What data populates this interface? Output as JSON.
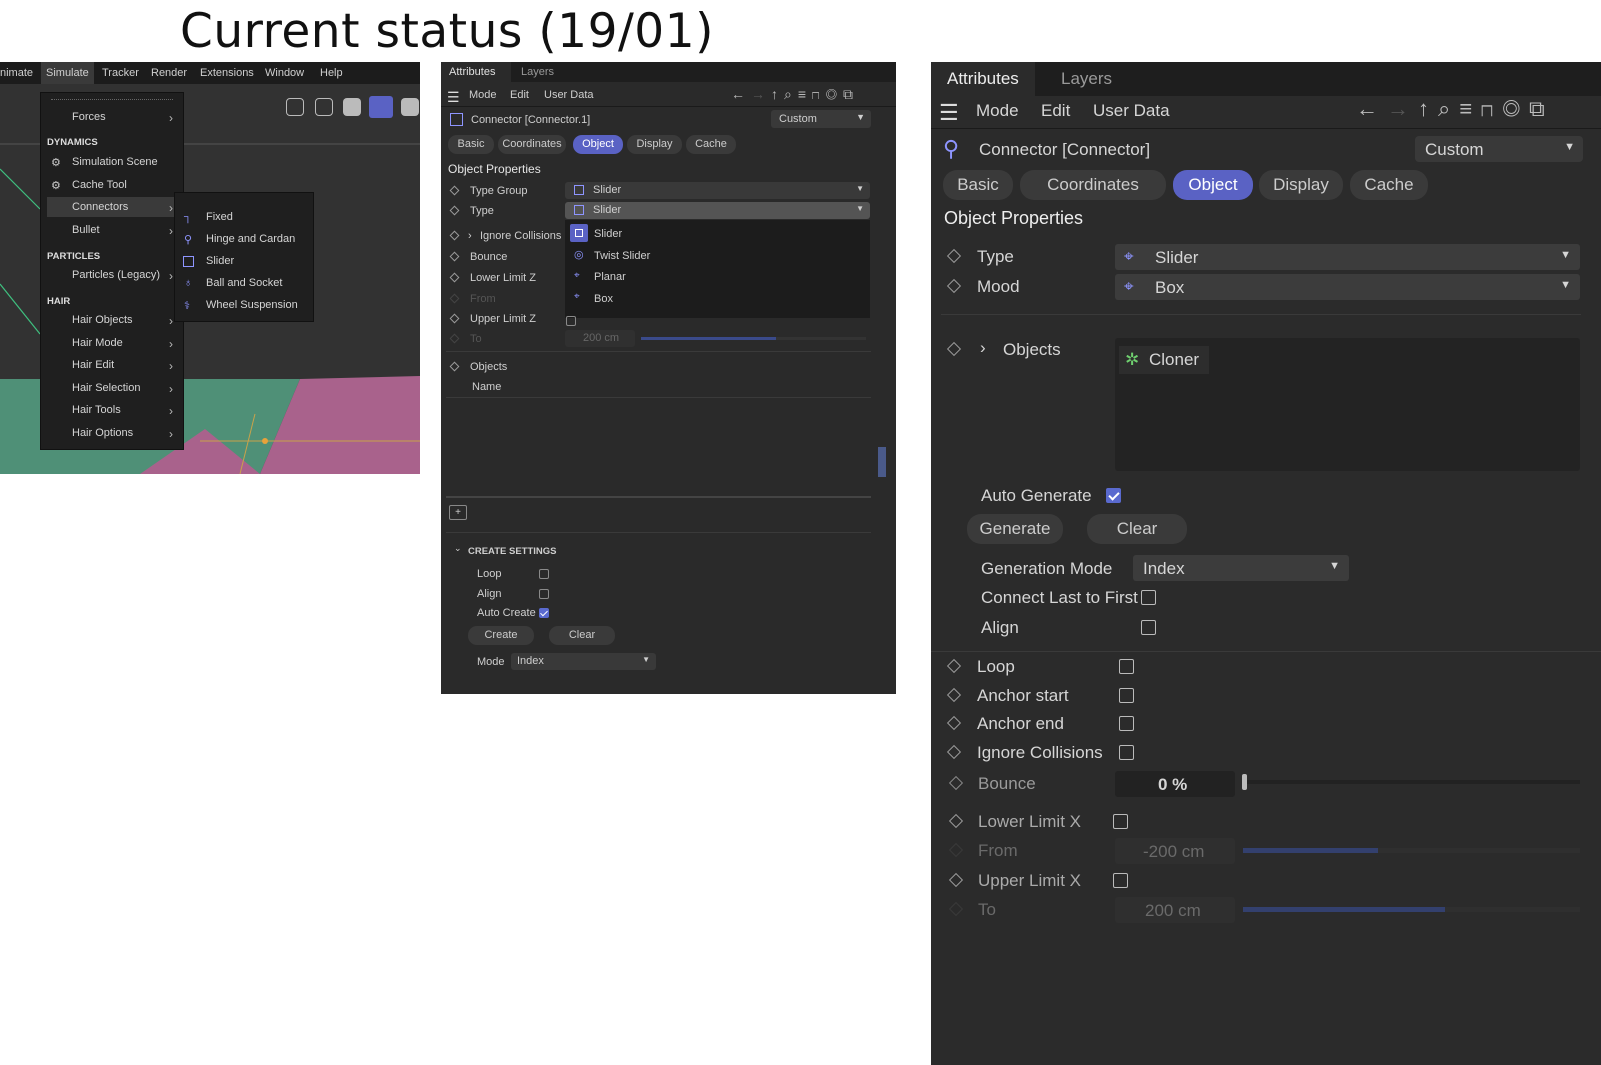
{
  "title": "Current status (19/01)",
  "panel1": {
    "menubar": [
      "nimate",
      "Simulate",
      "Tracker",
      "Render",
      "Extensions",
      "Window",
      "Help"
    ],
    "menu": {
      "forces": "Forces",
      "dynamics_header": "DYNAMICS",
      "simulation_scene": "Simulation Scene",
      "cache_tool": "Cache Tool",
      "connectors": "Connectors",
      "bullet": "Bullet",
      "particles_header": "PARTICLES",
      "particles_legacy": "Particles (Legacy)",
      "hair_header": "HAIR",
      "hair_items": [
        "Hair Objects",
        "Hair Mode",
        "Hair Edit",
        "Hair Selection",
        "Hair Tools",
        "Hair Options"
      ]
    },
    "submenu": [
      "Fixed",
      "Hinge and Cardan",
      "Slider",
      "Ball and Socket",
      "Wheel Suspension"
    ]
  },
  "panel2": {
    "tabs_top": [
      "Attributes",
      "Layers"
    ],
    "menu": [
      "Mode",
      "Edit",
      "User Data"
    ],
    "object_name": "Connector [Connector.1]",
    "preset": "Custom",
    "tabs": [
      "Basic",
      "Coordinates",
      "Object",
      "Display",
      "Cache"
    ],
    "section": "Object Properties",
    "labels": {
      "type_group": "Type Group",
      "type": "Type",
      "ignore_collisions": "Ignore Collisions",
      "bounce": "Bounce",
      "lower_limit": "Lower Limit Z",
      "from": "From",
      "upper_limit": "Upper Limit Z",
      "to": "To",
      "objects": "Objects",
      "name_col": "Name"
    },
    "type_group_value": "Slider",
    "type_value": "Slider",
    "to_value": "200 cm",
    "dropdown_options": [
      "Slider",
      "Twist Slider",
      "Planar",
      "Box"
    ],
    "create_settings": "CREATE SETTINGS",
    "loop": "Loop",
    "align": "Align",
    "auto_create": "Auto Create",
    "create_btn": "Create",
    "clear_btn": "Clear",
    "mode_label": "Mode",
    "mode_value": "Index"
  },
  "panel3": {
    "tabs_top": [
      "Attributes",
      "Layers"
    ],
    "menu": [
      "Mode",
      "Edit",
      "User Data"
    ],
    "object_name": "Connector [Connector]",
    "preset": "Custom",
    "tabs": [
      "Basic",
      "Coordinates",
      "Object",
      "Display",
      "Cache"
    ],
    "section": "Object Properties",
    "type_label": "Type",
    "type_value": "Slider",
    "mood_label": "Mood",
    "mood_value": "Box",
    "objects_label": "Objects",
    "cloner": "Cloner",
    "auto_generate": "Auto Generate",
    "generate_btn": "Generate",
    "clear_btn": "Clear",
    "generation_mode_label": "Generation Mode",
    "generation_mode_value": "Index",
    "connect_last": "Connect Last to First",
    "align": "Align",
    "loop": "Loop",
    "anchor_start": "Anchor start",
    "anchor_end": "Anchor end",
    "ignore_collisions": "Ignore Collisions",
    "bounce_label": "Bounce",
    "bounce_value": "0 %",
    "lower_limit": "Lower Limit X",
    "from_label": "From",
    "from_value": "-200 cm",
    "upper_limit": "Upper Limit X",
    "to_label": "To",
    "to_value": "200 cm"
  }
}
